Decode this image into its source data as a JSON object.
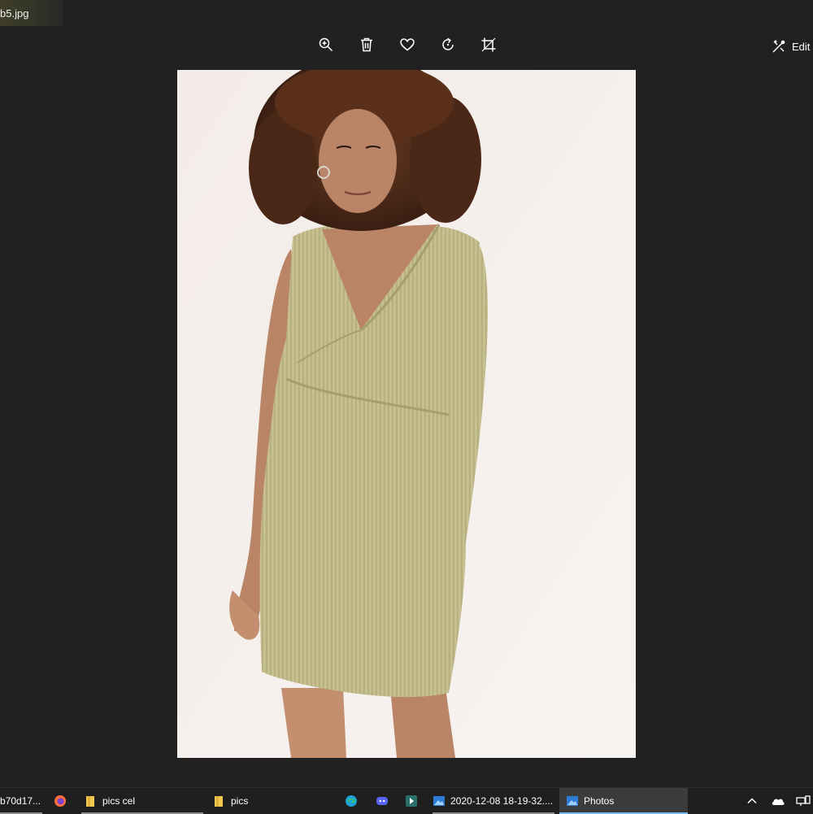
{
  "window": {
    "file_name": "b5.jpg"
  },
  "toolbar": {
    "zoom": "zoom-in-icon",
    "delete": "trash-icon",
    "favorite": "heart-icon",
    "rotate": "rotate-icon",
    "crop": "crop-icon",
    "edit_label": "Edit"
  },
  "taskbar": {
    "items": [
      {
        "label": "b70d17..."
      },
      {
        "label": ""
      },
      {
        "label": "pics cel"
      },
      {
        "label": "pics"
      },
      {
        "label": ""
      },
      {
        "label": ""
      },
      {
        "label": ""
      },
      {
        "label": "2020-12-08 18-19-32...."
      },
      {
        "label": "Photos"
      }
    ]
  },
  "colors": {
    "background": "#212121",
    "dress": "#c6c090",
    "photo_bg": "#f4eeeb",
    "accent": "#76b9ed"
  }
}
